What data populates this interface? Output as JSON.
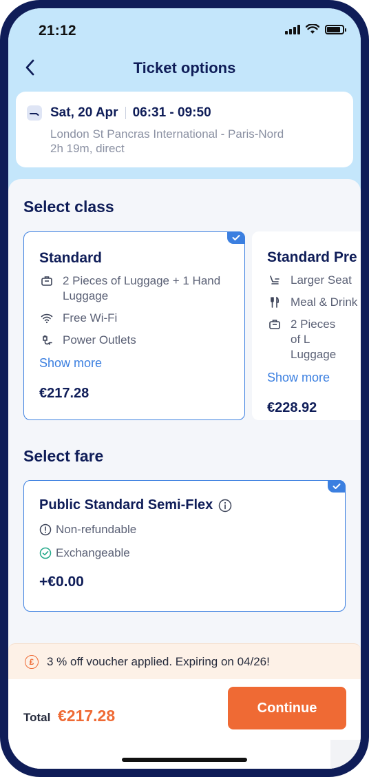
{
  "status": {
    "time": "21:12"
  },
  "header": {
    "title": "Ticket options"
  },
  "journey": {
    "date": "Sat, 20 Apr",
    "time": "06:31 - 09:50",
    "route": "London St Pancras International - Paris-Nord",
    "duration": "2h 19m, direct"
  },
  "select_class": {
    "title": "Select class",
    "cards": [
      {
        "title": "Standard",
        "selected": true,
        "features": [
          {
            "icon": "luggage-icon",
            "label": "2 Pieces of Luggage + 1 Hand Luggage"
          },
          {
            "icon": "wifi-icon",
            "label": "Free Wi-Fi"
          },
          {
            "icon": "power-outlet-icon",
            "label": "Power Outlets"
          }
        ],
        "show_more": "Show more",
        "price": "€217.28"
      },
      {
        "title": "Standard Pre",
        "selected": false,
        "features": [
          {
            "icon": "seat-icon",
            "label": "Larger Seat"
          },
          {
            "icon": "cutlery-icon",
            "label": "Meal & Drink"
          },
          {
            "icon": "luggage-icon",
            "label": "2 Pieces of L Luggage"
          }
        ],
        "show_more": "Show more",
        "price": "€228.92"
      }
    ]
  },
  "select_fare": {
    "title": "Select fare",
    "card": {
      "title": "Public Standard Semi-Flex",
      "lines": [
        {
          "icon": "exclamation-icon",
          "label": "Non-refundable"
        },
        {
          "icon": "check-circle-icon",
          "label": "Exchangeable"
        }
      ],
      "price": "+€0.00"
    }
  },
  "voucher": {
    "text": "3 % off voucher applied. Expiring on 04/26!",
    "icon_symbol": "£"
  },
  "footer": {
    "total_label": "Total",
    "total_value": "€217.28",
    "continue_label": "Continue"
  },
  "colors": {
    "accent": "#ef6a34",
    "primary": "#0f1d58",
    "link": "#3b7fe0",
    "header_bg": "#c4e6fb"
  }
}
